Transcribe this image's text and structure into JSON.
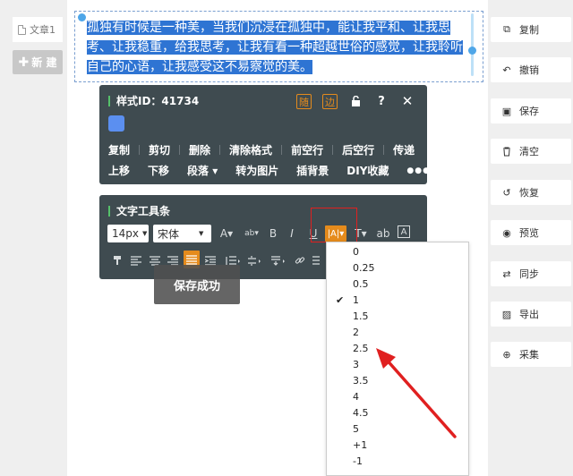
{
  "sidebar": {
    "doc_tab": "文章1",
    "new_button": "新 建",
    "new_icon": "plus-icon"
  },
  "editor": {
    "selected_text_lines": [
      "孤独有时候是一种美，当我们沉浸在孤独中，能让我平和、让我思",
      "考、让我稳重，给我思考，让我有看一种超越世俗的感觉，让我聆听",
      "自己的心语，让我感受这不易察觉的美。"
    ],
    "selection_color": "#2e74d3"
  },
  "style_panel": {
    "title": "样式ID：41734",
    "top_buttons": [
      "随",
      "边",
      "?",
      "✕"
    ],
    "swatch_color": "#5b8ff0",
    "row1": [
      "复制",
      "剪切",
      "删除",
      "清除格式",
      "前空行",
      "后空行",
      "传递"
    ],
    "row2": [
      "上移",
      "下移",
      "段落 ▾",
      "转为图片",
      "插背景",
      "DIY收藏",
      "●●●"
    ]
  },
  "text_toolbar": {
    "title": "文字工具条",
    "font_size": "14px",
    "font_family": "宋体",
    "row1_icons": [
      "A▾",
      "ab▾",
      "B",
      "I",
      "U",
      "|A|▾",
      "T▾",
      "ab",
      "A"
    ],
    "active_letter_spacing": "|A|▾"
  },
  "toast": {
    "message": "保存成功"
  },
  "letter_spacing_dropdown": {
    "options": [
      "0",
      "0.25",
      "0.5",
      "1",
      "1.5",
      "2",
      "2.5",
      "3",
      "3.5",
      "4",
      "4.5",
      "5",
      "+1",
      "-1"
    ],
    "selected": "1",
    "check_mark": "✔"
  },
  "right_panel": {
    "buttons": [
      {
        "label": "复制",
        "icon": "copy-icon",
        "glyph": "⧉"
      },
      {
        "label": "撤销",
        "icon": "undo-icon",
        "glyph": "↶"
      },
      {
        "label": "保存",
        "icon": "save-icon",
        "glyph": "▣"
      },
      {
        "label": "清空",
        "icon": "trash-icon",
        "glyph": "🗑"
      },
      {
        "label": "恢复",
        "icon": "restore-icon",
        "glyph": "↺"
      },
      {
        "label": "预览",
        "icon": "eye-icon",
        "glyph": "◉"
      },
      {
        "label": "同步",
        "icon": "sync-icon",
        "glyph": "⇄"
      },
      {
        "label": "导出",
        "icon": "export-image-icon",
        "glyph": "▨"
      },
      {
        "label": "采集",
        "icon": "search-plus-icon",
        "glyph": "⊕"
      }
    ]
  },
  "colors": {
    "panel_bg": "#3f4b50",
    "accent_orange": "#e58b1c",
    "annotation_red": "#e02020"
  }
}
